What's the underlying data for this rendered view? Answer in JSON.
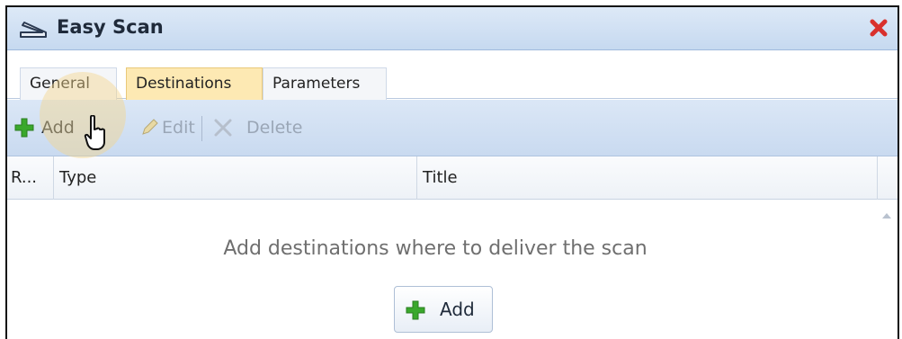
{
  "window": {
    "title": "Easy Scan",
    "icon": "scanner-icon",
    "close_icon": "close-icon"
  },
  "tabs": [
    {
      "label": "General",
      "active": false
    },
    {
      "label": "Destinations",
      "active": true
    },
    {
      "label": "Parameters",
      "active": false
    }
  ],
  "toolbar": {
    "add_label": "Add",
    "edit_label": "Edit",
    "delete_label": "Delete"
  },
  "grid": {
    "columns": [
      "R...",
      "Type",
      "Title"
    ],
    "empty_message": "Add destinations where to deliver the scan",
    "add_button_label": "Add"
  },
  "colors": {
    "active_tab": "#fde9b3",
    "add_icon": "#3aa82c",
    "close_icon": "#d9302c",
    "toolbar_bg": "#c9daf0"
  }
}
